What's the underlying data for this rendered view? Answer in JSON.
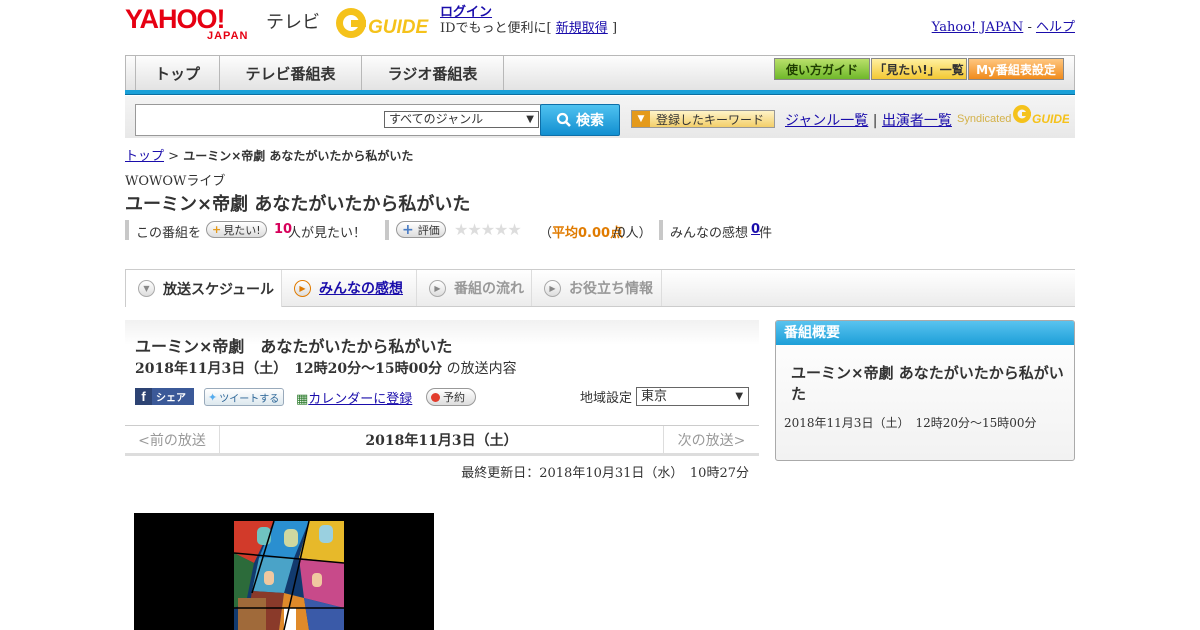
{
  "header": {
    "logo_text": "YAHOO!",
    "logo_sub": "JAPAN",
    "service_label": "テレビ",
    "gguide_logo": "G GUIDE",
    "login_label": "ログイン",
    "login_note_prefix": "IDでもっと便利に[",
    "signup_label": "新規取得",
    "login_note_suffix": "]",
    "yahoo_japan_link": "Yahoo! JAPAN",
    "separator": "-",
    "help_link": "ヘルプ"
  },
  "nav": {
    "tabs": [
      "トップ",
      "テレビ番組表",
      "ラジオ番組表"
    ],
    "buttons": [
      "使い方ガイド",
      "「見たい!」一覧",
      "My番組表設定"
    ]
  },
  "search": {
    "input_value": "",
    "genre_selected": "すべてのジャンル",
    "search_button": "検索",
    "keyword_button": "登録したキーワード",
    "genre_list_link": "ジャンル一覧",
    "divider": "|",
    "performer_list_link": "出演者一覧",
    "syndicated_label": "Syndicated"
  },
  "breadcrumb": {
    "top_link": "トップ",
    "sep": ">",
    "current": "ユーミン×帝劇 あなたがいたから私がいた"
  },
  "program": {
    "channel": "WOWOWライブ",
    "title": "ユーミン×帝劇 あなたがいたから私がいた",
    "want_prefix": "この番組を",
    "want_button": "見たい!",
    "want_count": "10",
    "want_suffix": "人が見たい！",
    "rate_button": "評価",
    "rating_open": "（",
    "rating_avg_label": "平均0.00点",
    "rating_people": "/0人）",
    "rating_stars": 0,
    "impressions_label": "みんなの感想",
    "impressions_count": "0",
    "impressions_unit": "件"
  },
  "tabs": [
    {
      "label": "放送スケジュール",
      "active": true
    },
    {
      "label": "みんなの感想",
      "active": false,
      "link": true
    },
    {
      "label": "番組の流れ",
      "active": false
    },
    {
      "label": "お役立ち情報",
      "active": false
    }
  ],
  "schedule": {
    "title": "ユーミン×帝劇　あなたがいたから私がいた",
    "datetime": "2018年11月3日（土）　12時20分～15時00分",
    "datetime_suffix": "の放送内容",
    "facebook_share": "シェア",
    "tweet_button": "ツイートする",
    "calendar_link": "カレンダーに登録",
    "reserve_button": "予約",
    "region_label": "地域設定",
    "region_selected": "東京",
    "prev_label": "<前の放送",
    "current_date": "2018年11月3日（土）",
    "next_label": "次の放送>",
    "updated": "最終更新日：2018年10月31日（水）　10時27分"
  },
  "sidebar": {
    "heading": "番組概要",
    "title": "ユーミン×帝劇 あなたがいたから私がいた",
    "datetime": "2018年11月3日（土）　12時20分～15時00分"
  },
  "colors": {
    "accent_blue": "#1aa0d8",
    "yahoo_red": "#e60012",
    "gguide_yellow": "#f5c21b",
    "want_count_pink": "#d6005a",
    "rating_orange": "#e07b00"
  }
}
